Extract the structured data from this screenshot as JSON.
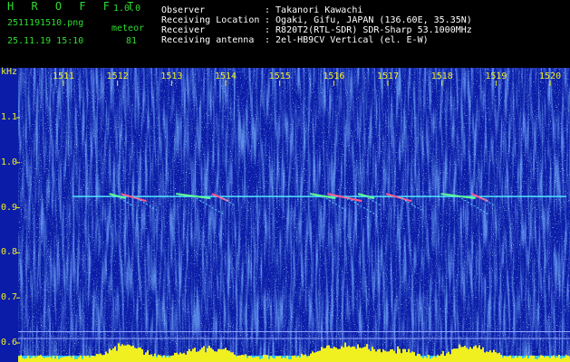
{
  "header": {
    "brand": "H R O F F T",
    "version": "1.0.0",
    "filename": "2511191510.png",
    "datetime": "25.11.19 15:10",
    "count_label": "meteor",
    "count_value": "81",
    "info_labels": [
      "Observer",
      "Receiving Location",
      "Receiver",
      "Receiving antenna"
    ],
    "info_values": [
      ": Takanori Kawachi",
      ": Ogaki, Gifu, JAPAN (136.60E, 35.35N)",
      ": R820T2(RTL-SDR) SDR-Sharp 53.1000MHz",
      ": 2el-HB9CV Vertical (el. E-W)"
    ]
  },
  "colors": {
    "text_green": "#2fdc2f",
    "text_yellow": "#f0f020",
    "background": "#0b1da8",
    "carrier": "#4fe6ff",
    "power_bar": "#f0f020",
    "power_base": "#30c8ff"
  },
  "chart_data": {
    "type": "heatmap",
    "y_unit": "kHz",
    "y_ticks": [
      "1.1",
      "1.0",
      "0.9",
      "0.8",
      "0.7",
      "0.6"
    ],
    "y_tick_values": [
      1.1,
      1.0,
      0.9,
      0.8,
      0.7,
      0.6
    ],
    "x_ticks": [
      "1511",
      "1512",
      "1513",
      "1514",
      "1515",
      "1516",
      "1517",
      "1518",
      "1519",
      "1520"
    ],
    "carrier_khz": 0.925,
    "meteor_bursts_minutes": [
      1512.0,
      1512.3,
      1513.4,
      1513.9,
      1515.8,
      1516.2,
      1516.6,
      1517.2,
      1518.3,
      1518.7
    ]
  }
}
